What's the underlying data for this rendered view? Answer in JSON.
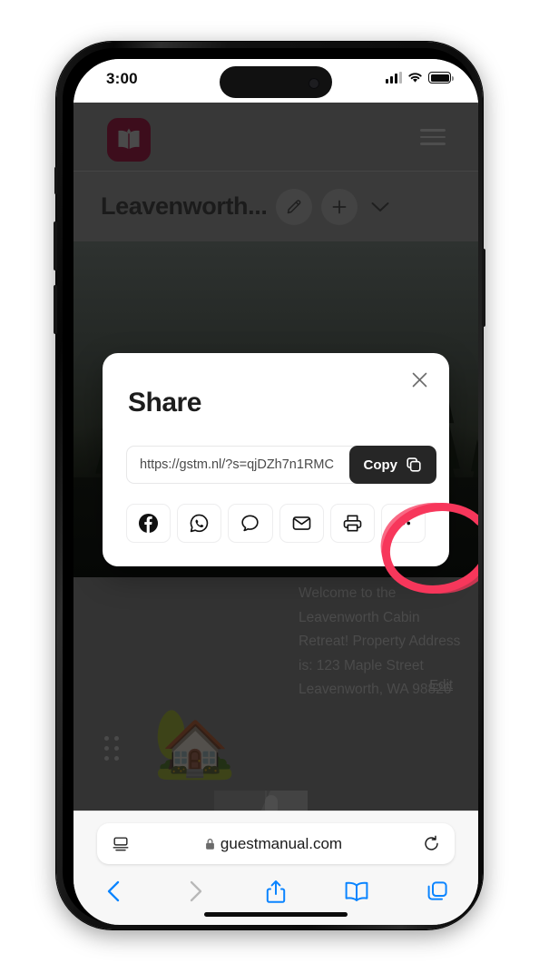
{
  "status_bar": {
    "time": "3:00",
    "cellular_icon": "signal-bars-icon",
    "wifi_icon": "wifi-icon",
    "battery_icon": "battery-icon"
  },
  "site_header": {
    "logo_icon": "open-book-logo-icon",
    "logo_color": "#3d0d1c",
    "menu_icon": "hamburger-menu-icon",
    "background": "#383838"
  },
  "title_bar": {
    "title": "Leavenworth...",
    "edit_icon": "pencil-icon",
    "add_icon": "plus-icon",
    "expand_icon": "chevron-down-icon"
  },
  "hero": {
    "description": "dark forest pine trees photo"
  },
  "body_content": {
    "drag_handle_icon": "drag-handle-dots-icon",
    "house_emoji": "🏡",
    "welcome_text": "Welcome to the Leavenworth Cabin Retreat!\nProperty Address is:\n123 Maple Street\nLeavenworth, WA 98826",
    "edit_link": "Edit",
    "map_thumbnail": "map-thumbnail-image"
  },
  "share_modal": {
    "title": "Share",
    "close_icon": "close-x-icon",
    "url_value": "https://gstm.nl/?s=qjDZh7n1RMC",
    "url_placeholder": "https://gstm.nl/?s=",
    "copy_label": "Copy",
    "copy_icon": "copy-duplicate-icon",
    "annotation_color": "#f7375b",
    "share_buttons": [
      {
        "name": "facebook",
        "icon": "facebook-icon"
      },
      {
        "name": "whatsapp",
        "icon": "whatsapp-icon"
      },
      {
        "name": "message",
        "icon": "chat-bubble-icon"
      },
      {
        "name": "email",
        "icon": "envelope-icon"
      },
      {
        "name": "print",
        "icon": "printer-icon"
      },
      {
        "name": "more",
        "icon": "ellipsis-icon"
      }
    ]
  },
  "safari": {
    "reader_icon": "reader-view-icon",
    "lock_icon": "lock-icon",
    "url": "guestmanual.com",
    "reload_icon": "reload-icon",
    "toolbar": [
      {
        "name": "back",
        "icon": "chevron-left-icon",
        "enabled": true
      },
      {
        "name": "forward",
        "icon": "chevron-right-icon",
        "enabled": false
      },
      {
        "name": "share",
        "icon": "share-up-arrow-icon",
        "enabled": true
      },
      {
        "name": "bookmarks",
        "icon": "book-icon",
        "enabled": true
      },
      {
        "name": "tabs",
        "icon": "tabs-squares-icon",
        "enabled": true
      }
    ],
    "accent_color": "#0a84ff"
  }
}
